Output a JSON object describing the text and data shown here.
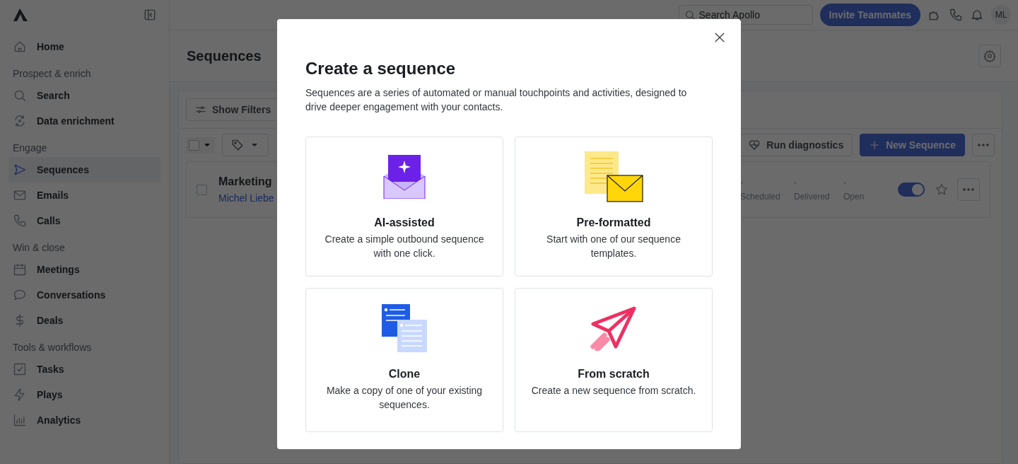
{
  "topbar": {
    "search": {
      "placeholder": "Search Apollo"
    },
    "invite_button": "Invite Teammates",
    "avatar": "ML"
  },
  "sidebar": {
    "sections": [
      {
        "items": [
          {
            "label": "Home",
            "selected": false
          }
        ]
      },
      {
        "label": "Prospect & enrich",
        "items": [
          {
            "label": "Search",
            "selected": false
          },
          {
            "label": "Data enrichment",
            "selected": false
          }
        ]
      },
      {
        "label": "Engage",
        "items": [
          {
            "label": "Sequences",
            "selected": true
          },
          {
            "label": "Emails",
            "selected": false
          },
          {
            "label": "Calls",
            "selected": false
          }
        ]
      },
      {
        "label": "Win & close",
        "items": [
          {
            "label": "Meetings",
            "selected": false
          },
          {
            "label": "Conversations",
            "selected": false
          },
          {
            "label": "Deals",
            "selected": false
          }
        ]
      },
      {
        "label": "Tools & workflows",
        "items": [
          {
            "label": "Tasks",
            "selected": false
          },
          {
            "label": "Plays",
            "selected": false
          },
          {
            "label": "Analytics",
            "selected": false
          }
        ]
      }
    ]
  },
  "page": {
    "title": "Sequences",
    "filters_button": "Show Filters",
    "diagnostics_button": "Run diagnostics",
    "new_button": "New Sequence",
    "select_all": {
      "checked": false
    },
    "sequences": [
      {
        "name": "Marketing",
        "owner": "Michel Liebe",
        "checked": false,
        "active": true,
        "starred": false,
        "stats": [
          {
            "value": "-",
            "label": "Scheduled"
          },
          {
            "value": "-",
            "label": "Delivered"
          },
          {
            "value": "-",
            "label": "Open"
          }
        ]
      }
    ]
  },
  "modal": {
    "title": "Create a sequence",
    "description": "Sequences are a series of automated or manual touchpoints and activities, designed to drive deeper engagement with your contacts.",
    "options": [
      {
        "kind": "ai",
        "title": "AI-assisted",
        "description": "Create a simple outbound sequence with one click."
      },
      {
        "kind": "template",
        "title": "Pre-formatted",
        "description": "Start with one of our sequence templates."
      },
      {
        "kind": "clone",
        "title": "Clone",
        "description": "Make a copy of one of your existing sequences."
      },
      {
        "kind": "scratch",
        "title": "From scratch",
        "description": "Create a new sequence from scratch."
      }
    ]
  }
}
